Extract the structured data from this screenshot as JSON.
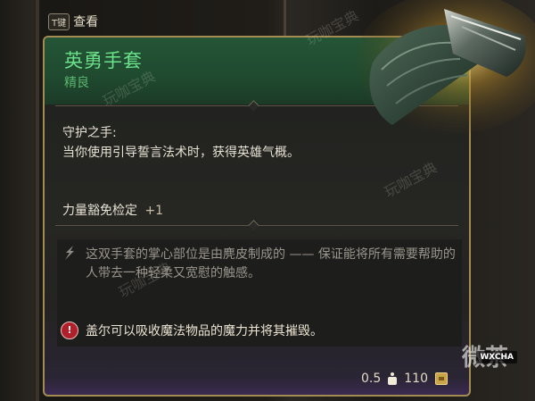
{
  "hint": {
    "key": "T键",
    "label": "查看"
  },
  "item": {
    "name": "英勇手套",
    "rarity": "精良",
    "passive_title": "守护之手:",
    "passive_text": "当你使用引导誓言法术时，获得英雄气概。",
    "bonus_label": "力量豁免检定",
    "bonus_value": "+1",
    "lore": "这双手套的掌心部位是由麂皮制成的 —— 保证能将所有需要帮助的人带去一种轻柔又宽慰的触感。",
    "special": "盖尔可以吸收魔法物品的魔力并将其摧毁。",
    "weight": "0.5",
    "price": "110"
  },
  "watermark": "玩咖宝典",
  "badge": {
    "text": "微茶",
    "chip": "WXCHA"
  },
  "colors": {
    "name": "#6be18a",
    "rarity": "#5ab56f",
    "border": "#a48b52",
    "warn": "#b01f2a"
  },
  "icons": {
    "lore": "quill-icon",
    "warn": "alert-icon",
    "weight": "weight-icon",
    "price": "coin-icon"
  }
}
